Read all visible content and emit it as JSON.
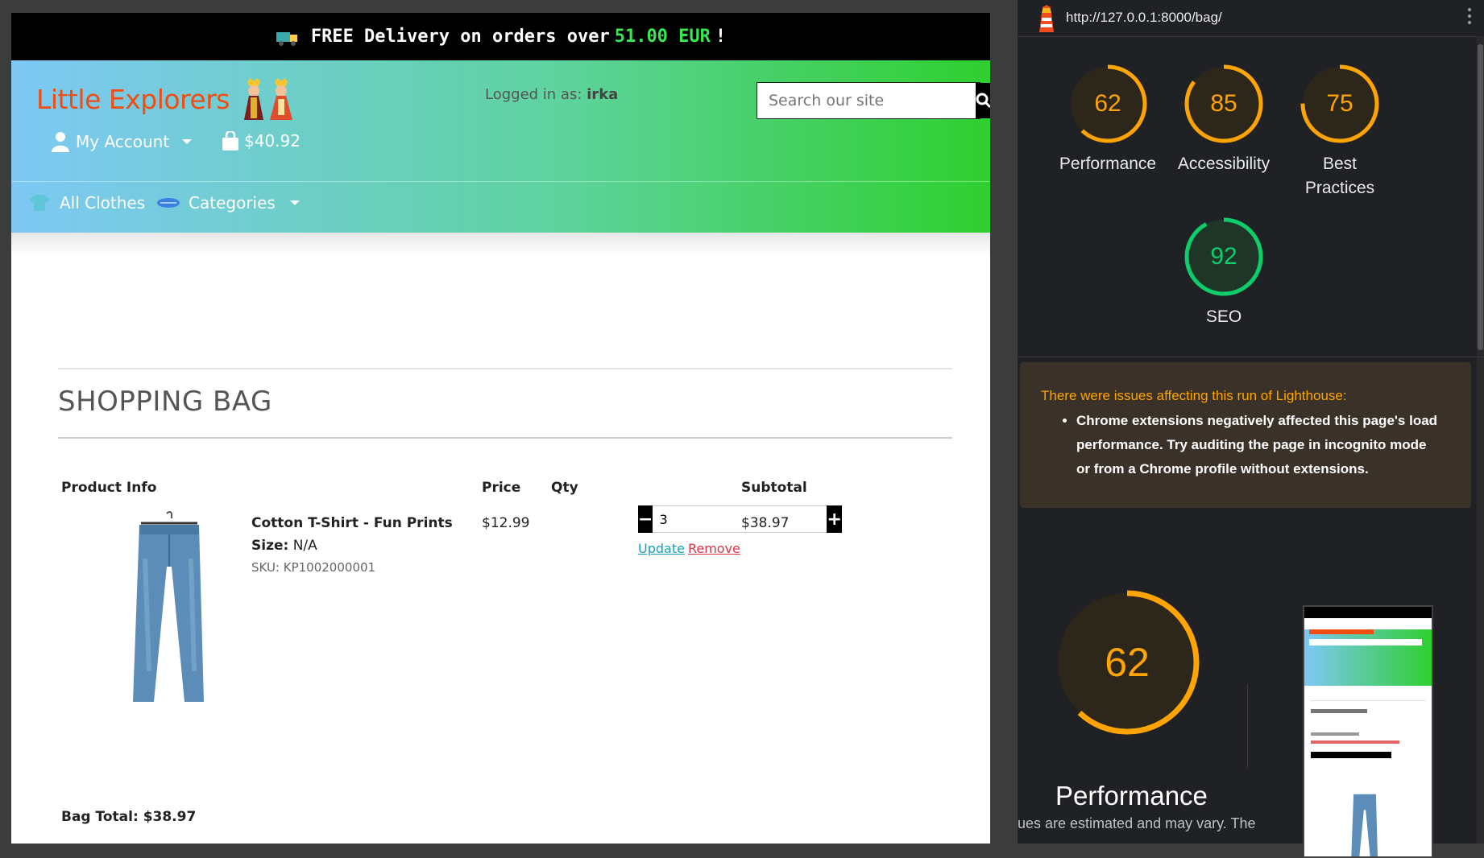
{
  "promo": {
    "text_pre": "FREE Delivery on orders over",
    "amount": "51.00 EUR",
    "text_post": "!"
  },
  "header": {
    "brand": "Little Explorers",
    "logged_in_label": "Logged in as:",
    "username": "irka",
    "search_placeholder": "Search our site",
    "account_label": "My Account",
    "bag_total": "$40.92"
  },
  "nav": {
    "all_clothes": "All Clothes",
    "categories": "Categories"
  },
  "bag": {
    "title": "SHOPPING BAG",
    "columns": {
      "product": "Product Info",
      "price": "Price",
      "qty": "Qty",
      "subtotal": "Subtotal"
    },
    "item": {
      "name": "Cotton T-Shirt - Fun Prints",
      "size_label": "Size:",
      "size": "N/A",
      "sku": "SKU: KP1002000001",
      "price": "$12.99",
      "qty": "3",
      "subtotal": "$38.97",
      "update": "Update",
      "remove": "Remove"
    },
    "total_label": "Bag Total:",
    "total": "$38.97"
  },
  "lighthouse": {
    "url": "http://127.0.0.1:8000/bag/",
    "scores": [
      {
        "label": "Performance",
        "value": "62",
        "level": 0.62,
        "color": "#ffa400"
      },
      {
        "label": "Accessibility",
        "value": "85",
        "level": 0.85,
        "color": "#ffa400"
      },
      {
        "label": "Best Practices",
        "value": "75",
        "level": 0.75,
        "color": "#ffa400"
      },
      {
        "label": "SEO",
        "value": "92",
        "level": 0.92,
        "color": "#0cce6b"
      }
    ],
    "warning_title": "There were issues affecting this run of Lighthouse:",
    "warning_item": "Chrome extensions negatively affected this page's load performance. Try auditing the page in incognito mode or from a Chrome profile without extensions.",
    "big_score": "62",
    "big_label": "Performance",
    "note": "ues are estimated and may vary. The"
  },
  "colors": {
    "warn": "#ffa400",
    "pass": "#0cce6b",
    "brand": "#f04d12",
    "promo_amount": "#37e84f"
  }
}
